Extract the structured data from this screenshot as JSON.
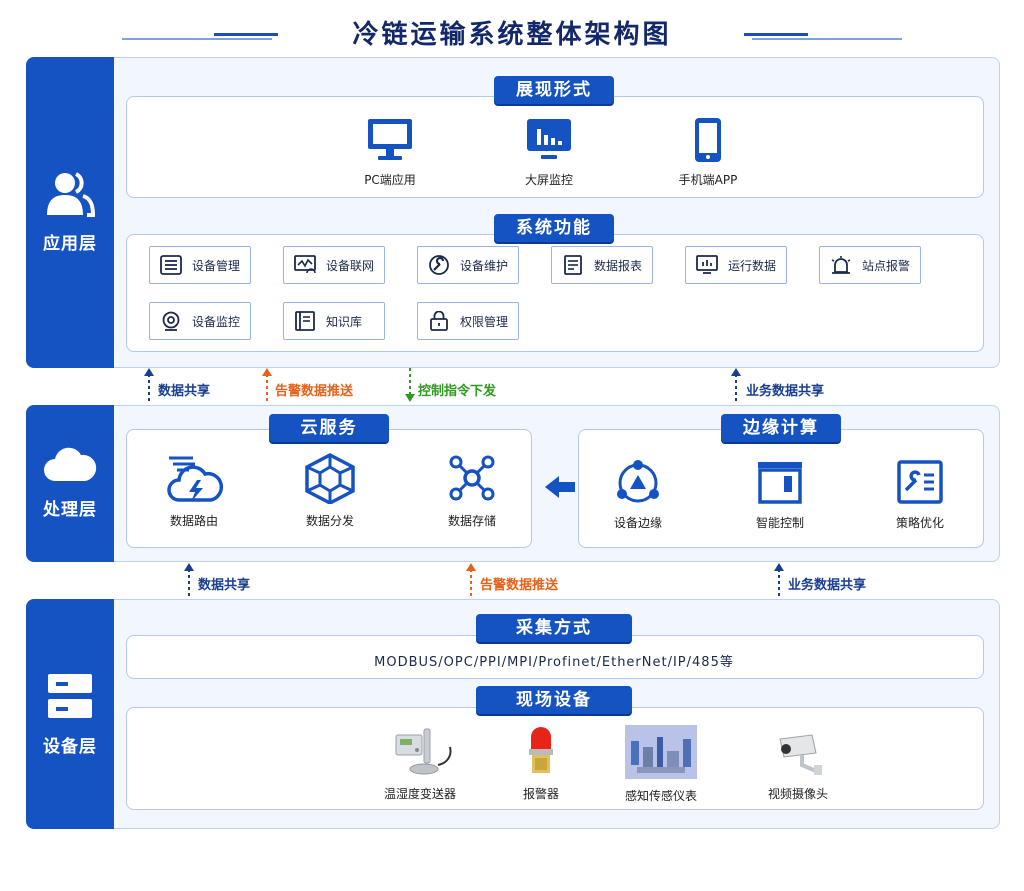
{
  "title": "冷链运输系统整体架构图",
  "layers": {
    "app": {
      "name": "应用层",
      "display": {
        "heading": "展现形式",
        "items": [
          "PC端应用",
          "大屏监控",
          "手机端APP"
        ]
      },
      "functions": {
        "heading": "系统功能",
        "items": [
          "设备管理",
          "设备联网",
          "设备维护",
          "数据报表",
          "运行数据",
          "站点报警",
          "设备监控",
          "知识库",
          "权限管理"
        ]
      }
    },
    "process": {
      "name": "处理层",
      "cloud": {
        "heading": "云服务",
        "items": [
          "数据路由",
          "数据分发",
          "数据存储"
        ]
      },
      "edge": {
        "heading": "边缘计算",
        "items": [
          "设备边缘",
          "智能控制",
          "策略优化"
        ]
      }
    },
    "device": {
      "name": "设备层",
      "collect": {
        "heading": "采集方式",
        "protocols": "MODBUS/OPC/PPI/MPI/Profinet/EtherNet/IP/485等"
      },
      "field": {
        "heading": "现场设备",
        "items": [
          "温湿度变送器",
          "报警器",
          "感知传感仪表",
          "视频摄像头"
        ]
      }
    }
  },
  "arrows_upper": [
    "数据共享",
    "告警数据推送",
    "控制指令下发",
    "业务数据共享"
  ],
  "arrows_lower": [
    "数据共享",
    "告警数据推送",
    "业务数据共享"
  ],
  "colors": {
    "primary": "#1552c2",
    "orange": "#e8611a",
    "green": "#2e9a1f"
  }
}
